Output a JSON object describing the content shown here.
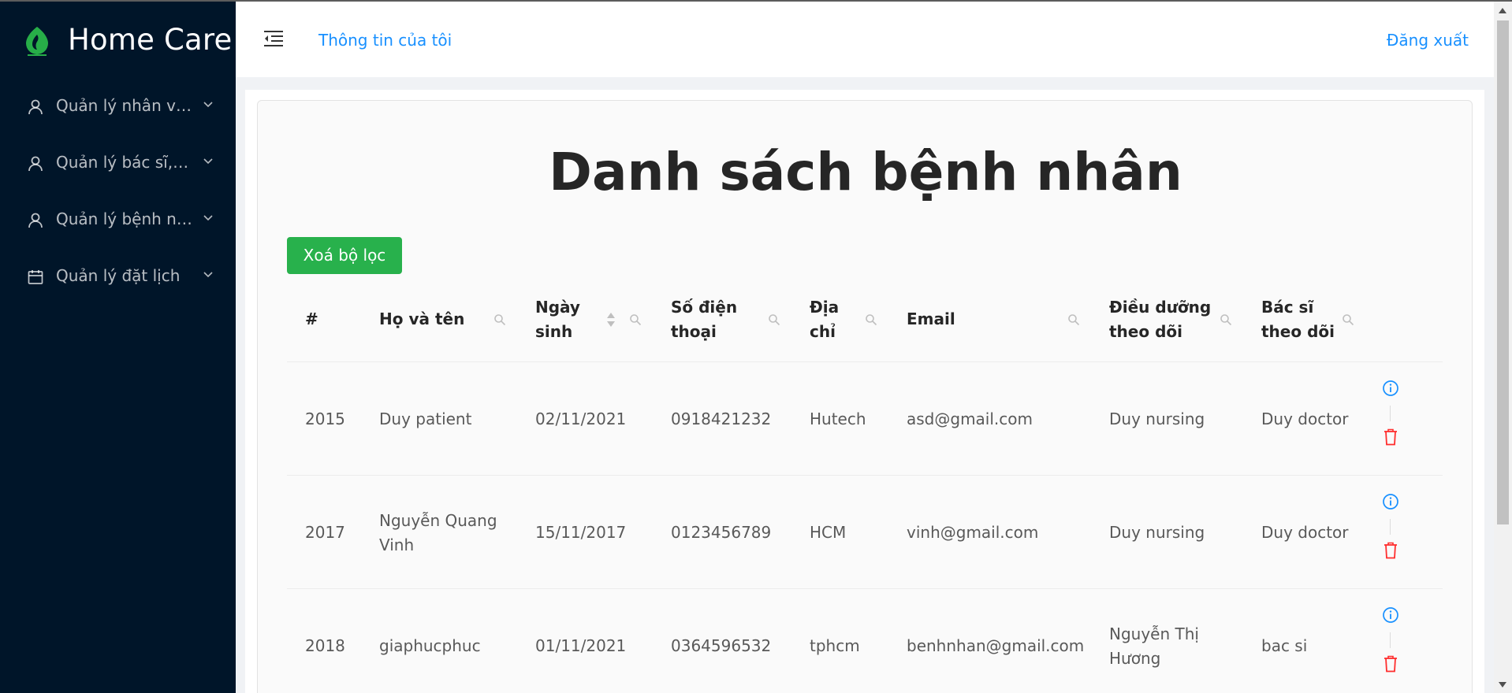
{
  "app": {
    "title": "Home Care",
    "logo": "leaf-drop-logo"
  },
  "sidebar": {
    "items": [
      {
        "label": "Quản lý nhân viên",
        "icon": "user-icon"
      },
      {
        "label": "Quản lý bác sĩ, điều dưỡng",
        "icon": "user-icon"
      },
      {
        "label": "Quản lý bệnh nhân",
        "icon": "user-icon"
      },
      {
        "label": "Quản lý đặt lịch",
        "icon": "calendar-icon"
      }
    ]
  },
  "header": {
    "my_info": "Thông tin của tôi",
    "logout": "Đăng xuất"
  },
  "main": {
    "title": "Danh sách bệnh nhân",
    "clear_filter_label": "Xoá bộ lọc"
  },
  "table": {
    "columns": [
      {
        "key": "id",
        "label": "#"
      },
      {
        "key": "name",
        "label": "Họ và tên"
      },
      {
        "key": "dob",
        "label": "Ngày sinh"
      },
      {
        "key": "phone",
        "label": "Số điện thoại"
      },
      {
        "key": "address",
        "label": "Địa chỉ"
      },
      {
        "key": "email",
        "label": "Email"
      },
      {
        "key": "nurse",
        "label": "Điều dưỡng theo dõi"
      },
      {
        "key": "doctor",
        "label": "Bác sĩ theo dõi"
      }
    ],
    "rows": [
      {
        "id": "2015",
        "name": "Duy patient",
        "dob": "02/11/2021",
        "phone": "0918421232",
        "address": "Hutech",
        "email": "asd@gmail.com",
        "nurse": "Duy nursing",
        "doctor": "Duy doctor"
      },
      {
        "id": "2017",
        "name": "Nguyễn Quang Vinh",
        "dob": "15/11/2017",
        "phone": "0123456789",
        "address": "HCM",
        "email": "vinh@gmail.com",
        "nurse": "Duy nursing",
        "doctor": "Duy doctor"
      },
      {
        "id": "2018",
        "name": "giaphucphuc",
        "dob": "01/11/2021",
        "phone": "0364596532",
        "address": "tphcm",
        "email": "benhnhan@gmail.com",
        "nurse": "Nguyễn Thị Hương",
        "doctor": "bac si"
      }
    ]
  },
  "colors": {
    "sidebar_bg": "#001529",
    "link": "#1890ff",
    "primary_button": "#28b14c",
    "delete": "#ff2d2d",
    "info": "#1890ff"
  }
}
